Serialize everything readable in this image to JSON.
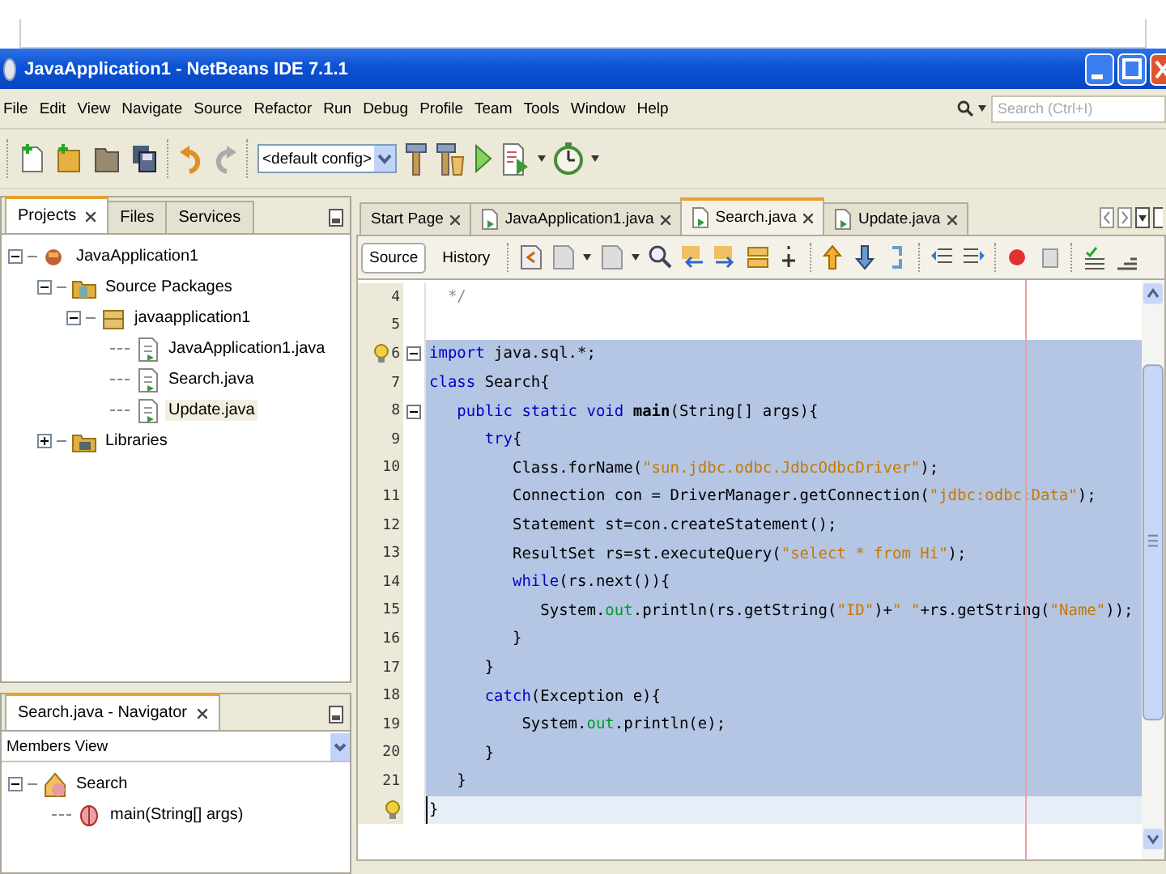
{
  "window": {
    "title": "JavaApplication1 - NetBeans IDE 7.1.1"
  },
  "menu": [
    "File",
    "Edit",
    "View",
    "Navigate",
    "Source",
    "Refactor",
    "Run",
    "Debug",
    "Profile",
    "Team",
    "Tools",
    "Window",
    "Help"
  ],
  "search": {
    "placeholder": "Search (Ctrl+I)"
  },
  "toolbar": {
    "config": "<default config>"
  },
  "projects": {
    "tabs": [
      {
        "label": "Projects",
        "selected": true,
        "closable": true
      },
      {
        "label": "Files",
        "selected": false,
        "closable": false
      },
      {
        "label": "Services",
        "selected": false,
        "closable": false
      }
    ],
    "tree": [
      {
        "label": "JavaApplication1",
        "kind": "project",
        "expanded": true,
        "selected": false,
        "children": [
          {
            "label": "Source Packages",
            "kind": "folder",
            "expanded": true,
            "selected": false,
            "children": [
              {
                "label": "javaapplication1",
                "kind": "package",
                "expanded": true,
                "selected": false,
                "children": [
                  {
                    "label": "JavaApplication1.java",
                    "kind": "file",
                    "selected": false
                  },
                  {
                    "label": "Search.java",
                    "kind": "file",
                    "selected": false
                  },
                  {
                    "label": "Update.java",
                    "kind": "file",
                    "selected": true
                  }
                ]
              }
            ]
          },
          {
            "label": "Libraries",
            "kind": "library",
            "expanded": false,
            "selected": false
          }
        ]
      }
    ]
  },
  "navigator": {
    "title": "Search.java - Navigator",
    "view": "Members View",
    "tree": [
      {
        "label": "Search",
        "kind": "class",
        "expanded": true,
        "selected": false,
        "children": [
          {
            "label": "main(String[] args)",
            "kind": "method",
            "selected": false
          }
        ]
      }
    ]
  },
  "editor": {
    "tabs": [
      {
        "label": "Start Page",
        "kind": "page",
        "selected": false
      },
      {
        "label": "JavaApplication1.java",
        "kind": "file",
        "selected": false
      },
      {
        "label": "Search.java",
        "kind": "file",
        "selected": true
      },
      {
        "label": "Update.java",
        "kind": "file",
        "selected": false
      }
    ],
    "views": [
      {
        "label": "Source",
        "selected": true
      },
      {
        "label": "History",
        "selected": false
      }
    ],
    "lines": [
      {
        "number": "4",
        "selected": false,
        "current": false,
        "fold": false,
        "hint": false,
        "segments": [
          {
            "text": "  */",
            "kind": "comment"
          }
        ]
      },
      {
        "number": "5",
        "selected": false,
        "current": false,
        "fold": false,
        "hint": false
      },
      {
        "number": "6",
        "selected": true,
        "current": false,
        "fold": true,
        "hint": true,
        "segments": [
          {
            "text": "import",
            "kind": "keyword"
          },
          {
            "text": " java.sql.*;",
            "kind": "plain"
          }
        ]
      },
      {
        "number": "7",
        "selected": true,
        "current": false,
        "fold": false,
        "hint": false,
        "segments": [
          {
            "text": "class",
            "kind": "keyword"
          },
          {
            "text": " Search{",
            "kind": "plain"
          }
        ]
      },
      {
        "number": "8",
        "selected": true,
        "current": false,
        "fold": true,
        "hint": false,
        "segments": [
          {
            "text": "   public static void ",
            "kind": "keyword"
          },
          {
            "text": "main",
            "kind": "declaration"
          },
          {
            "text": "(String[] args){",
            "kind": "plain"
          }
        ]
      },
      {
        "number": "9",
        "selected": true,
        "current": false,
        "fold": false,
        "hint": false,
        "segments": [
          {
            "text": "      try",
            "kind": "keyword"
          },
          {
            "text": "{",
            "kind": "plain"
          }
        ]
      },
      {
        "number": "10",
        "selected": true,
        "current": false,
        "fold": false,
        "hint": false,
        "segments": [
          {
            "text": "         Class.forName(",
            "kind": "plain"
          },
          {
            "text": "\"sun.jdbc.odbc.JdbcOdbcDriver\"",
            "kind": "string"
          },
          {
            "text": ");",
            "kind": "plain"
          }
        ]
      },
      {
        "number": "11",
        "selected": true,
        "current": false,
        "fold": false,
        "hint": false,
        "segments": [
          {
            "text": "         Connection con = DriverManager.getConnection(",
            "kind": "plain"
          },
          {
            "text": "\"jdbc:odbc:Data\"",
            "kind": "string"
          },
          {
            "text": ");",
            "kind": "plain"
          }
        ]
      },
      {
        "number": "12",
        "selected": true,
        "current": false,
        "fold": false,
        "hint": false,
        "segments": [
          {
            "text": "         Statement st=con.createStatement();",
            "kind": "plain"
          }
        ]
      },
      {
        "number": "13",
        "selected": true,
        "current": false,
        "fold": false,
        "hint": false,
        "segments": [
          {
            "text": "         ResultSet rs=st.executeQuery(",
            "kind": "plain"
          },
          {
            "text": "\"select * from Hi\"",
            "kind": "string"
          },
          {
            "text": ");",
            "kind": "plain"
          }
        ]
      },
      {
        "number": "14",
        "selected": true,
        "current": false,
        "fold": false,
        "hint": false,
        "segments": [
          {
            "text": "         while",
            "kind": "keyword"
          },
          {
            "text": "(rs.next()){",
            "kind": "plain"
          }
        ]
      },
      {
        "number": "15",
        "selected": true,
        "current": false,
        "fold": false,
        "hint": false,
        "segments": [
          {
            "text": "            System.",
            "kind": "plain"
          },
          {
            "text": "out",
            "kind": "field"
          },
          {
            "text": ".println(rs.getString(",
            "kind": "plain"
          },
          {
            "text": "\"ID\"",
            "kind": "string"
          },
          {
            "text": ")+",
            "kind": "plain"
          },
          {
            "text": "\" \"",
            "kind": "string"
          },
          {
            "text": "+rs.getString(",
            "kind": "plain"
          },
          {
            "text": "\"Name\"",
            "kind": "string"
          },
          {
            "text": "));",
            "kind": "plain"
          }
        ]
      },
      {
        "number": "16",
        "selected": true,
        "current": false,
        "fold": false,
        "hint": false,
        "segments": [
          {
            "text": "         }",
            "kind": "plain"
          }
        ]
      },
      {
        "number": "17",
        "selected": true,
        "current": false,
        "fold": false,
        "hint": false,
        "segments": [
          {
            "text": "      }",
            "kind": "plain"
          }
        ]
      },
      {
        "number": "18",
        "selected": true,
        "current": false,
        "fold": false,
        "hint": false,
        "segments": [
          {
            "text": "      catch",
            "kind": "keyword"
          },
          {
            "text": "(Exception e){",
            "kind": "plain"
          }
        ]
      },
      {
        "number": "19",
        "selected": true,
        "current": false,
        "fold": false,
        "hint": false,
        "segments": [
          {
            "text": "          System.",
            "kind": "plain"
          },
          {
            "text": "out",
            "kind": "field"
          },
          {
            "text": ".println(e);",
            "kind": "plain"
          }
        ]
      },
      {
        "number": "20",
        "selected": true,
        "current": false,
        "fold": false,
        "hint": false,
        "segments": [
          {
            "text": "      }",
            "kind": "plain"
          }
        ]
      },
      {
        "number": "21",
        "selected": true,
        "current": false,
        "fold": false,
        "hint": false,
        "segments": [
          {
            "text": "   }",
            "kind": "plain"
          }
        ]
      },
      {
        "selected": false,
        "current": true,
        "fold": false,
        "hint": true,
        "segments": [
          {
            "text": "}",
            "kind": "plain"
          }
        ]
      }
    ]
  }
}
